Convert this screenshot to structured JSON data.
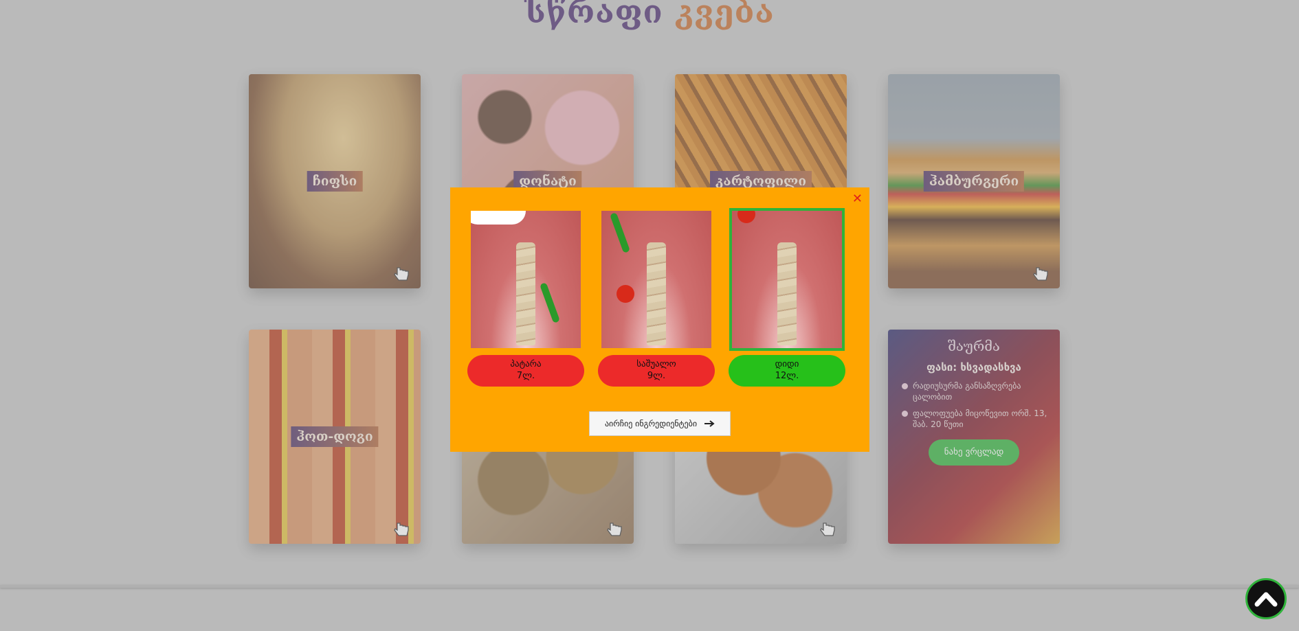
{
  "page_title": {
    "part1": "სწრაფი",
    "part2": "კვება"
  },
  "menu": [
    {
      "id": "c1",
      "label": "ჩიფსი"
    },
    {
      "id": "c2",
      "label": "დონატი"
    },
    {
      "id": "c3",
      "label": "კარტოფილი"
    },
    {
      "id": "c4",
      "label": "ჰამბურგერი"
    },
    {
      "id": "c5",
      "label": "ჰოთ-დოგი"
    },
    {
      "id": "c6",
      "label": ""
    },
    {
      "id": "c7",
      "label": ""
    }
  ],
  "promo": {
    "title": "შაურმა",
    "price": "ფასი: ხსვადასხვა",
    "bullets": [
      "რადიუსურმა განსაზღვრება ცალობით",
      "ფალოფუება მიცოწევით ორშ. 13, შაბ. 20 წუთი"
    ],
    "button": "ნახე ვრცლად"
  },
  "modal": {
    "options": [
      {
        "size": "პატარა",
        "price": "7ლ.",
        "selected": false
      },
      {
        "size": "საშუალო",
        "price": "9ლ.",
        "selected": false
      },
      {
        "size": "დიდი",
        "price": "12ლ.",
        "selected": true
      }
    ],
    "choose_button": "აირჩიე ინგრედიენტები"
  },
  "colors": {
    "modal_bg": "#ffa500",
    "option_btn": "#ec2a2a",
    "selected_btn": "#26c01a",
    "accent_green": "#2fb33a"
  }
}
